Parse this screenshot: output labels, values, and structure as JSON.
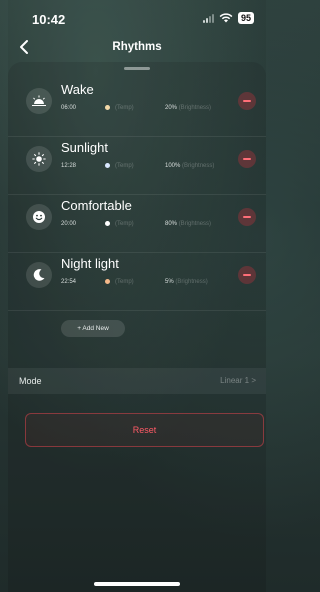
{
  "status_bar": {
    "time": "10:42",
    "battery": "95"
  },
  "nav": {
    "title": "Rhythms"
  },
  "rhythms": [
    {
      "name": "Wake",
      "time": "06:00",
      "temp_label": "(Temp)",
      "brightness": "20%",
      "brightness_label": "(Brightness)",
      "icon": "sunrise-icon",
      "dot_color": "#f3d9a8"
    },
    {
      "name": "Sunlight",
      "time": "12:28",
      "temp_label": "(Temp)",
      "brightness": "100%",
      "brightness_label": "(Brightness)",
      "icon": "sun-icon",
      "dot_color": "#d9e8ff"
    },
    {
      "name": "Comfortable",
      "time": "20:00",
      "temp_label": "(Temp)",
      "brightness": "80%",
      "brightness_label": "(Brightness)",
      "icon": "smile-icon",
      "dot_color": "#ffffff"
    },
    {
      "name": "Night light",
      "time": "22:54",
      "temp_label": "(Temp)",
      "brightness": "5%",
      "brightness_label": "(Brightness)",
      "icon": "moon-icon",
      "dot_color": "#f5b98a"
    }
  ],
  "add_new": {
    "label": "+ Add New"
  },
  "mode": {
    "label": "Mode",
    "value": "Linear 1",
    "chevron": ">"
  },
  "reset": {
    "label": "Reset"
  },
  "colors": {
    "accent_red": "#ff5a66"
  }
}
